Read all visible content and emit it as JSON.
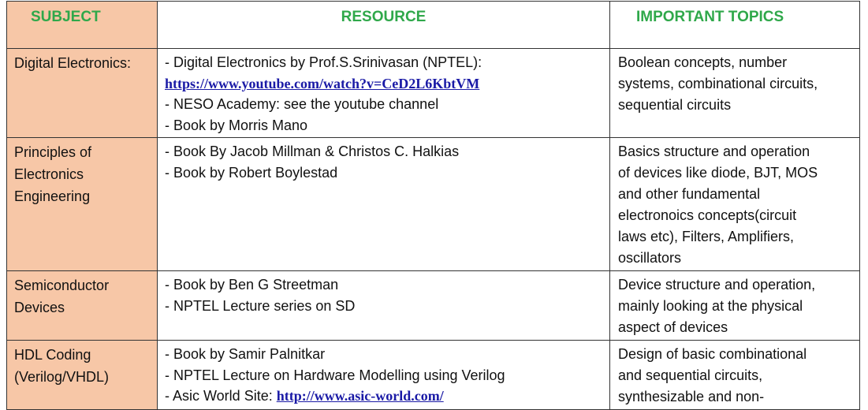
{
  "headers": {
    "subject": "SUBJECT",
    "resource": "RESOURCE",
    "topics": "IMPORTANT TOPICS"
  },
  "rows": [
    {
      "subject": [
        "Digital Electronics:"
      ],
      "resource": [
        {
          "text": "- Digital Electronics by Prof.S.Srinivasan (NPTEL):"
        },
        {
          "link": "https://www.youtube.com/watch?v=CeD2L6KbtVM"
        },
        {
          "text": "- NESO Academy: see the youtube channel"
        },
        {
          "text": "- Book by Morris Mano"
        }
      ],
      "topics": [
        "Boolean concepts, number",
        "systems, combinational circuits,",
        "sequential circuits"
      ]
    },
    {
      "subject": [
        "Principles of",
        "Electronics",
        "Engineering"
      ],
      "resource": [
        {
          "text": "- Book By  Jacob Millman & Christos C. Halkias"
        },
        {
          "text": "- Book by Robert Boylestad"
        }
      ],
      "topics": [
        "Basics structure and operation",
        "of devices like diode, BJT, MOS",
        "and other fundamental",
        "electronoics concepts(circuit",
        "laws etc), Filters, Amplifiers,",
        "oscillators"
      ]
    },
    {
      "subject": [
        "Semiconductor",
        "Devices"
      ],
      "resource": [
        {
          "text": "- Book by Ben G Streetman"
        },
        {
          "text": "- NPTEL Lecture series on SD"
        }
      ],
      "topics": [
        "Device structure and operation,",
        "mainly looking at the physical",
        "aspect of devices"
      ]
    },
    {
      "subject": [
        "HDL Coding",
        "(Verilog/VHDL)"
      ],
      "resource": [
        {
          "text": "- Book by Samir Palnitkar"
        },
        {
          "text": "- NPTEL Lecture on Hardware Modelling using Verilog"
        },
        {
          "text": "- Asic World Site: ",
          "link": "http://www.asic-world.com/"
        }
      ],
      "topics": [
        "Design of basic combinational",
        "and sequential circuits,",
        "synthesizable and non-"
      ]
    }
  ]
}
